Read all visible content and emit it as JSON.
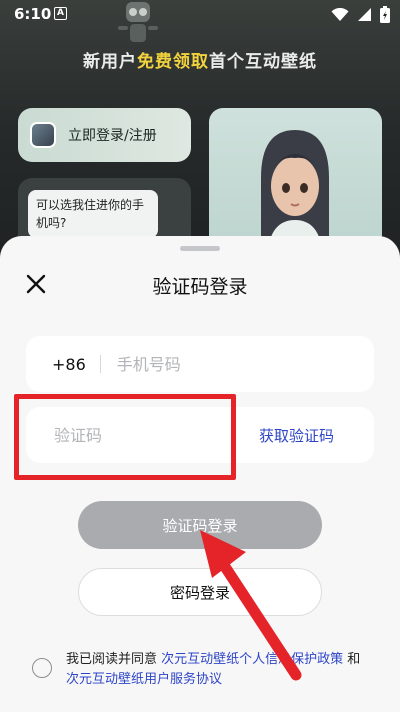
{
  "status_bar": {
    "time": "6:10",
    "notif_glyph": "A"
  },
  "background": {
    "banner_prefix": "新用户",
    "banner_highlight": "免费领取",
    "banner_suffix": "首个互动壁纸",
    "login_card_label": "立即登录/注册",
    "chat_bubble_text": "可以选我住进你的手机吗?"
  },
  "sheet": {
    "title": "验证码登录",
    "country_code": "+86",
    "phone_placeholder": "手机号码",
    "code_placeholder": "验证码",
    "get_code_label": "获取验证码",
    "code_login_label": "验证码登录",
    "password_login_label": "密码登录",
    "agreement": {
      "prefix": "我已阅读并同意 ",
      "privacy_link": "次元互动壁纸个人信息保护政策",
      "and": " 和 ",
      "service_link": "次元互动壁纸用户服务协议"
    }
  },
  "colors": {
    "accent": "#2e45c7",
    "highlight": "#e5242a",
    "banner_highlight": "#f2d23d",
    "disabled_button": "#aaabaf"
  },
  "icons": [
    "close-icon",
    "wifi-icon",
    "signal-icon",
    "battery-icon",
    "notification-icon"
  ]
}
